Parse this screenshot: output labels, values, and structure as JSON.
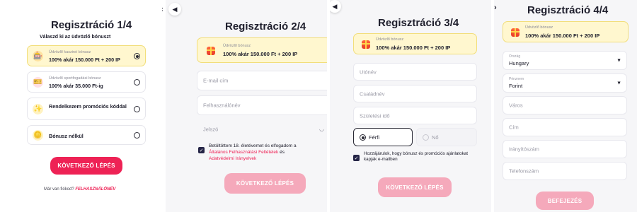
{
  "colors": {
    "accent": "#ee2255",
    "accent_faded": "#f5a9bb",
    "highlight": "#fff7cf",
    "checkbox": "#252547"
  },
  "step1": {
    "title": "Regisztráció 1/4",
    "subtitle": "Válaszd ki az üdvözlő bónuszt",
    "options": [
      {
        "icon": "casino-chip-icon",
        "small": "Üdvözlő kaszinó bónusz",
        "big": "100% akár 150.000 Ft + 200 IP",
        "selected": true
      },
      {
        "icon": "sports-bet-icon",
        "small": "Üdvözlő sportfogadási bónusz",
        "big": "100% akár 35.000 Ft-ig",
        "selected": false
      },
      {
        "icon": "promo-sparkle-icon",
        "small": "",
        "big": "Rendelkezem promóciós kóddal",
        "selected": false
      },
      {
        "icon": "coin-icon",
        "small": "",
        "big": "Bónusz nélkül",
        "selected": false
      }
    ],
    "button": "KÖVETKEZŐ LÉPÉS",
    "login_prefix": "Már van fiókod?",
    "login_link": "FELHASZNÁLÓNÉV",
    "close_icon": "×"
  },
  "step2": {
    "title": "Regisztráció 2/4",
    "bonus_small": "Üdvözlő bónusz",
    "bonus_big": "100% akár 150.000 Ft + 200 IP",
    "email_placeholder": "E-mail cím",
    "username_placeholder": "Felhasználónév",
    "password_placeholder": "Jelszó",
    "consent_text": "Betöltöttem 18. életévemet és elfogadom a",
    "consent_link1": "Általános Felhasználási Feltételek",
    "consent_and": " és",
    "consent_link2": "Adatvédelmi Irányelvek",
    "button": "KÖVETKEZŐ LÉPÉS"
  },
  "step3": {
    "title": "Regisztráció 3/4",
    "bonus_small": "Üdvözlő bónusz",
    "bonus_big": "100% akár 150.000 Ft + 200 IP",
    "firstname_placeholder": "Utónév",
    "lastname_placeholder": "Családnév",
    "birthdate_placeholder": "Születési idő",
    "gender_male": "Férfi",
    "gender_female": "Nő",
    "consent_text": "Hozzájárulok, hogy bónusz és promóciós ajánlatokat kapjak e-mailben",
    "button": "KÖVETKEZŐ LÉPÉS"
  },
  "step4": {
    "title": "Regisztráció 4/4",
    "bonus_small": "Üdvözlő bónusz",
    "bonus_big": "100% akár 150.000 Ft + 200 IP",
    "country_label": "Ország",
    "country_value": "Hungary",
    "currency_label": "Pénznem",
    "currency_value": "Forint",
    "city_placeholder": "Város",
    "address_placeholder": "Cím",
    "zip_placeholder": "Irányítószám",
    "phone_placeholder": "Telefonszám",
    "button": "BEFEJEZÉS"
  },
  "nav": {
    "back": "◀",
    "forward": "›"
  }
}
